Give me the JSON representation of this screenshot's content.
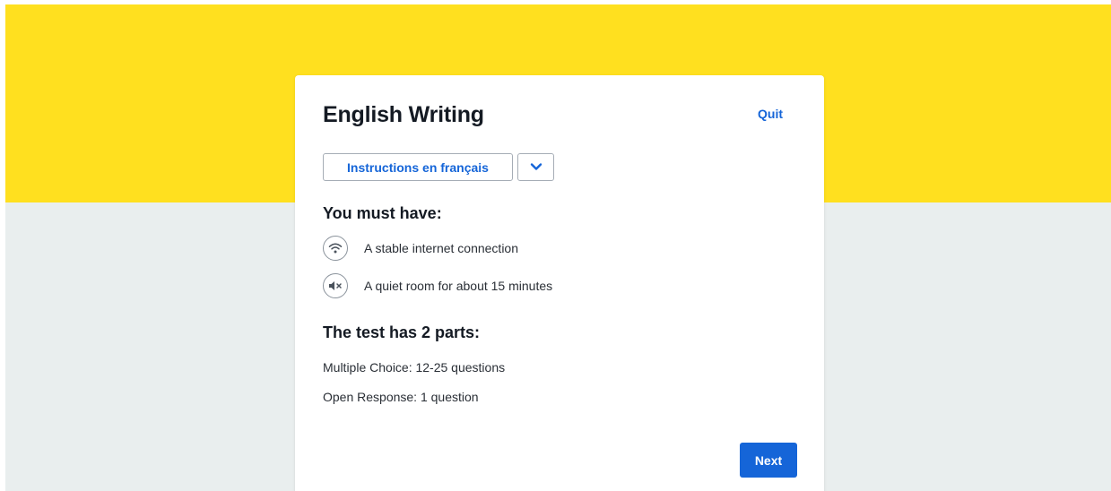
{
  "test": {
    "title": "English Writing",
    "quit_label": "Quit"
  },
  "language": {
    "button_label": "Instructions en français",
    "toggle_icon": "chevron-down-icon"
  },
  "requirements": {
    "heading": "You must have:",
    "items": [
      {
        "icon": "wifi-icon",
        "text": "A stable internet connection"
      },
      {
        "icon": "muted-speaker-icon",
        "text": "A quiet room for about 15 minutes"
      }
    ]
  },
  "parts": {
    "heading": "The test has 2 parts:",
    "items": [
      "Multiple Choice: 12-25 questions",
      "Open Response: 1 question"
    ]
  },
  "footer": {
    "next_label": "Next"
  },
  "colors": {
    "banner": "#ffe01f",
    "background": "#e9eeee",
    "accent": "#1565d8"
  }
}
